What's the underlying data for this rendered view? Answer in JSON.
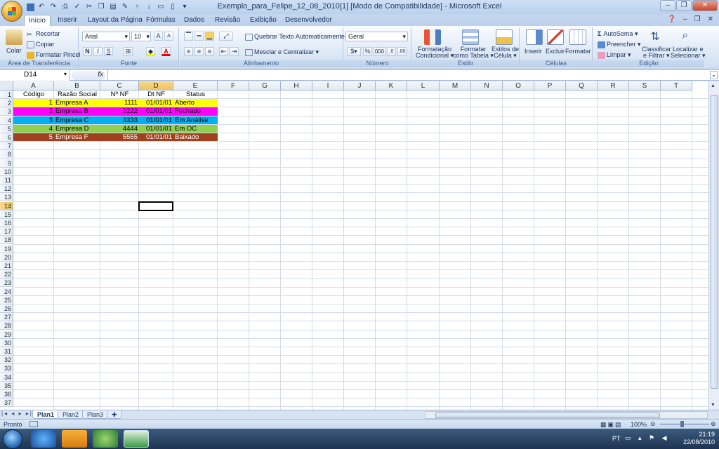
{
  "window": {
    "title": "Exemplo_para_Felipe_12_08_2010[1]  [Modo de Compatibilidade] - Microsoft Excel"
  },
  "ribbon_tabs": [
    "Início",
    "Inserir",
    "Layout da Página",
    "Fórmulas",
    "Dados",
    "Revisão",
    "Exibição",
    "Desenvolvedor"
  ],
  "clipboard": {
    "paste": "Colar",
    "cut": "Recortar",
    "copy": "Copiar",
    "format_painter": "Formatar Pincel",
    "label": "Área de Transferência"
  },
  "font": {
    "name": "Arial",
    "size": "10",
    "bold": "N",
    "italic": "I",
    "underline": "S",
    "label": "Fonte"
  },
  "alignment": {
    "wrap": "Quebrar Texto Automaticamente",
    "merge": "Mesclar e Centralizar",
    "label": "Alinhamento"
  },
  "number": {
    "format": "Geral",
    "percent": "%",
    "thousands": "000",
    "label": "Número"
  },
  "styles": {
    "conditional": [
      "Formatação",
      "Condicional"
    ],
    "as_table": [
      "Formatar",
      "como Tabela"
    ],
    "cell_styles": [
      "Estilos de",
      "Célula"
    ],
    "label": "Estilo"
  },
  "cells": {
    "insert": "Inserir",
    "delete": "Excluir",
    "format": "Formatar",
    "label": "Células"
  },
  "editing": {
    "autosum": "AutoSoma",
    "fill": "Preencher",
    "clear": "Limpar",
    "sort": [
      "Classificar",
      "e Filtrar"
    ],
    "find": [
      "Localizar e",
      "Selecionar"
    ],
    "label": "Edição"
  },
  "formula_bar": {
    "name_box": "D14",
    "fx": "fx"
  },
  "columns": [
    "A",
    "B",
    "C",
    "D",
    "E",
    "F",
    "G",
    "H",
    "I",
    "J",
    "K",
    "L",
    "M",
    "N",
    "O",
    "P",
    "Q",
    "R",
    "S",
    "T"
  ],
  "selected_column": "D",
  "selected_row": 14,
  "row_count": 37,
  "header_row": [
    "Código",
    "Razão Social",
    "Nº NF",
    "Dt NF",
    "Status"
  ],
  "data_rows": [
    {
      "codigo": "1",
      "razao": "Empresa A",
      "nf": "1111",
      "dt": "01/01/01",
      "status": "Aberto",
      "bg": "#ffff00",
      "fg": "#000000"
    },
    {
      "codigo": "2",
      "razao": "Empresa B",
      "nf": "2222",
      "dt": "01/01/01",
      "status": "Fechado",
      "bg": "#ff00ff",
      "fg": "#000000"
    },
    {
      "codigo": "3",
      "razao": "Empresa C",
      "nf": "3333",
      "dt": "01/01/01",
      "status": "Em Análise",
      "bg": "#00b0f0",
      "fg": "#000000"
    },
    {
      "codigo": "4",
      "razao": "Empresa D",
      "nf": "4444",
      "dt": "01/01/01",
      "status": "Em OC",
      "bg": "#92d050",
      "fg": "#000000"
    },
    {
      "codigo": "5",
      "razao": "Empresa F",
      "nf": "5555",
      "dt": "01/01/01",
      "status": "Baixado",
      "bg": "#a0401f",
      "fg": "#ffffff"
    }
  ],
  "sheets": [
    "Plan1",
    "Plan2",
    "Plan3"
  ],
  "active_sheet": "Plan1",
  "status": {
    "ready": "Pronto",
    "zoom": "100%"
  },
  "taskbar": {
    "lang": "PT",
    "time": "21:19",
    "date": "22/08/2010"
  }
}
